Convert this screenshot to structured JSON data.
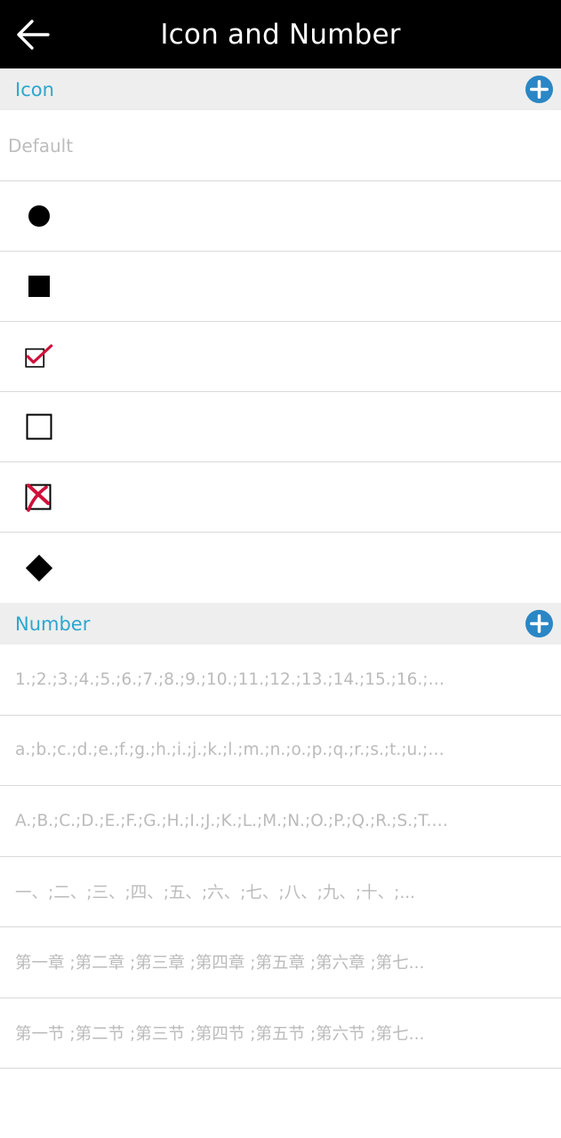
{
  "header": {
    "title": "Icon and Number",
    "back_icon": "arrow-left-icon"
  },
  "icon_section": {
    "label": "Icon",
    "add_icon": "plus-circle-icon",
    "accent_color": "#2ba7cf",
    "default_label": "Default",
    "items": [
      {
        "name": "black-circle-icon"
      },
      {
        "name": "black-square-icon"
      },
      {
        "name": "checked-box-icon"
      },
      {
        "name": "empty-box-icon"
      },
      {
        "name": "crossed-box-icon"
      },
      {
        "name": "black-diamond-icon"
      }
    ]
  },
  "number_section": {
    "label": "Number",
    "add_icon": "plus-circle-icon",
    "items": [
      "1.;2.;3.;4.;5.;6.;7.;8.;9.;10.;11.;12.;13.;14.;15.;16.;17...",
      "a.;b.;c.;d.;e.;f.;g.;h.;i.;j.;k.;l.;m.;n.;o.;p.;q.;r.;s.;t.;u.;v.;w...",
      "A.;B.;C.;D.;E.;F.;G.;H.;I.;J.;K.;L.;M.;N.;O.;P.;Q.;R.;S.;T.;...",
      "一、;二、;三、;四、;五、;六、;七、;八、;九、;十、;...",
      "第一章 ;第二章 ;第三章 ;第四章 ;第五章 ;第六章 ;第七...",
      "第一节 ;第二节 ;第三节 ;第四节 ;第五节 ;第六节 ;第七..."
    ]
  }
}
